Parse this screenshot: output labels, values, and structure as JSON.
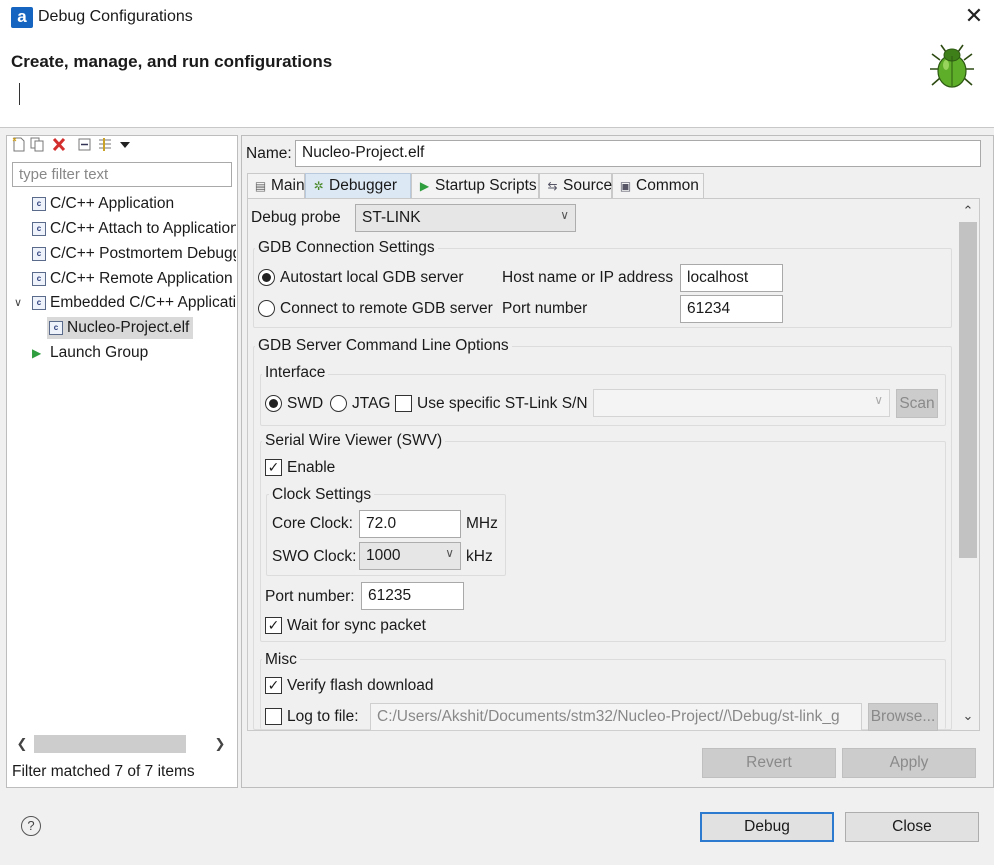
{
  "window": {
    "title": "Debug Configurations",
    "app_icon_letter": "a",
    "close": "✕"
  },
  "header": {
    "title": "Create, manage, and run configurations"
  },
  "left": {
    "filter_placeholder": "type filter text",
    "items": [
      {
        "label": "C/C++ Application"
      },
      {
        "label": "C/C++ Attach to Application"
      },
      {
        "label": "C/C++ Postmortem Debugger"
      },
      {
        "label": "C/C++ Remote Application"
      },
      {
        "label": "Embedded C/C++ Application"
      },
      {
        "label": "Nucleo-Project.elf"
      },
      {
        "label": "Launch Group"
      }
    ],
    "status": "Filter matched 7 of 7 items"
  },
  "config": {
    "name_label": "Name:",
    "name_value": "Nucleo-Project.elf",
    "tabs": [
      {
        "label": "Main"
      },
      {
        "label": "Debugger"
      },
      {
        "label": "Startup Scripts"
      },
      {
        "label": "Source"
      },
      {
        "label": "Common"
      }
    ],
    "active_tab": "Debugger"
  },
  "debugger": {
    "probe_label": "Debug probe",
    "probe_value": "ST-LINK",
    "gdb_conn": {
      "title": "GDB Connection Settings",
      "autostart": "Autostart local GDB server",
      "connect_remote": "Connect to remote GDB server",
      "host_label": "Host name or IP address",
      "host_value": "localhost",
      "port_label": "Port number",
      "port_value": "61234"
    },
    "server_opts": {
      "title": "GDB Server Command Line Options",
      "interface_title": "Interface",
      "swd": "SWD",
      "jtag": "JTAG",
      "specific_sn": "Use specific ST-Link S/N",
      "scan": "Scan"
    },
    "swv": {
      "title": "Serial Wire Viewer (SWV)",
      "enable": "Enable",
      "clock_title": "Clock Settings",
      "core_clock_label": "Core Clock:",
      "core_clock_value": "72.0",
      "core_clock_unit": "MHz",
      "swo_clock_label": "SWO Clock:",
      "swo_clock_value": "1000",
      "swo_clock_unit": "kHz",
      "port_label": "Port number:",
      "port_value": "61235",
      "wait_sync": "Wait for sync packet"
    },
    "misc": {
      "title": "Misc",
      "verify_flash": "Verify flash download",
      "log_to_file": "Log to file:",
      "log_path": "C:/Users/Akshit/Documents/stm32/Nucleo-Project//\\Debug/st-link_g",
      "browse": "Browse..."
    }
  },
  "buttons": {
    "revert": "Revert",
    "apply": "Apply",
    "debug": "Debug",
    "close": "Close"
  },
  "help": "?"
}
